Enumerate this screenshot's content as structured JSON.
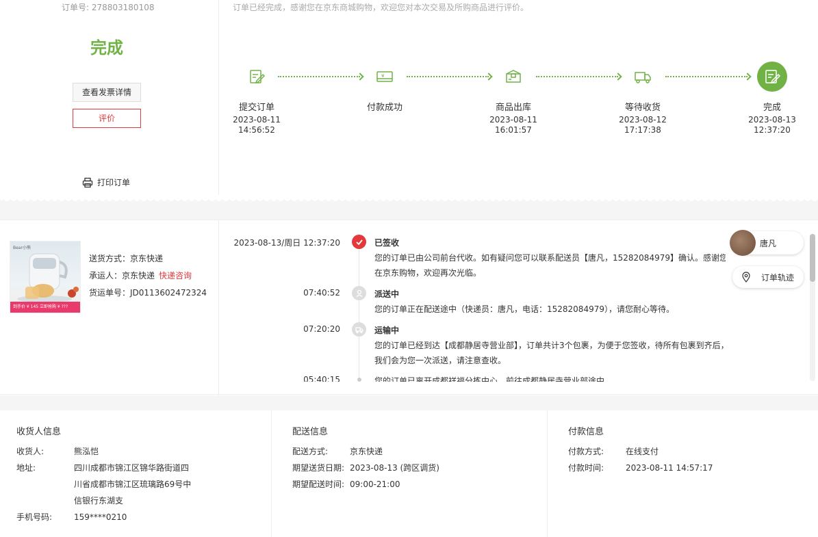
{
  "order": {
    "number_label": "订单号: 278803180108",
    "status": "完成",
    "invoice_button": "查看发票详情",
    "review_button": "评价",
    "print_label": "打印订单",
    "thanks_message": "订单已经完成，感谢您在京东商城购物，欢迎您对本次交易及所购商品进行评价。"
  },
  "steps": [
    {
      "name": "提交订单",
      "date": "2023-08-11",
      "time": "14:56:52",
      "icon": "order-submit-icon"
    },
    {
      "name": "付款成功",
      "date": "",
      "time": "",
      "icon": "payment-card-icon"
    },
    {
      "name": "商品出库",
      "date": "2023-08-11",
      "time": "16:01:57",
      "icon": "package-box-icon"
    },
    {
      "name": "等待收货",
      "date": "2023-08-12",
      "time": "17:17:38",
      "icon": "delivery-truck-icon"
    },
    {
      "name": "完成",
      "date": "2023-08-13",
      "time": "12:37:20",
      "icon": "complete-check-icon"
    }
  ],
  "shipping": {
    "method": "送货方式：京东快递",
    "carrier": "承运人：京东快递",
    "carrier_link": "快递咨询",
    "waybill": "货运单号：JD0113602472324"
  },
  "product": {
    "logo_text": "Bear小熊",
    "band_text": "到手价 ¥ 145    立即抢购 ¥ ???"
  },
  "tracking": [
    {
      "time": "2023-08-13/周日   12:37:20",
      "title": "已签收",
      "text": "您的订单已由公司前台代收。如有疑问您可以联系配送员【唐凡，15282084979】确认。感谢您在京东购物，欢迎再次光临。",
      "icon": "check-circle-icon"
    },
    {
      "time": "07:40:52",
      "title": "派送中",
      "text": "您的订单正在配送途中（快递员：唐凡，电话：15282084979），请您耐心等待。",
      "icon": "courier-icon"
    },
    {
      "time": "07:20:20",
      "title": "运输中",
      "text": "您的订单已经到达【成都静居寺营业部】，订单共计3个包裹，为便于您签收，待所有包裹到齐后，我们会为您一次派送，请注意查收。",
      "icon": "transit-icon"
    },
    {
      "time": "05:40:15",
      "title": "",
      "text": "您的订单已离开成都祥福分拣中心，前往成都静居寺营业部途中",
      "icon": ""
    }
  ],
  "courier": {
    "name": "唐凡"
  },
  "trace_button": "订单轨迹",
  "receiver": {
    "title": "收货人信息",
    "rows": [
      {
        "k": "收货人:",
        "v": "熊泓恺"
      },
      {
        "k": "地址:",
        "v": "四川成都市锦江区锦华路街道四川省成都市锦江区琉璃路69号中信银行东湖支"
      },
      {
        "k": "手机号码:",
        "v": "159****0210"
      }
    ]
  },
  "delivery": {
    "title": "配送信息",
    "rows": [
      {
        "k": "配送方式:",
        "v": "京东快递"
      },
      {
        "k": "期望送货日期:",
        "v": "2023-08-13 (跨区调货)"
      },
      {
        "k": "期望配送时间:",
        "v": "09:00-21:00"
      }
    ]
  },
  "payment": {
    "title": "付款信息",
    "rows": [
      {
        "k": "付款方式:",
        "v": "在线支付"
      },
      {
        "k": "付款时间:",
        "v": "2023-08-11 14:57:17"
      }
    ]
  },
  "colors": {
    "accent_green": "#71b247",
    "accent_red": "#e4393c"
  }
}
